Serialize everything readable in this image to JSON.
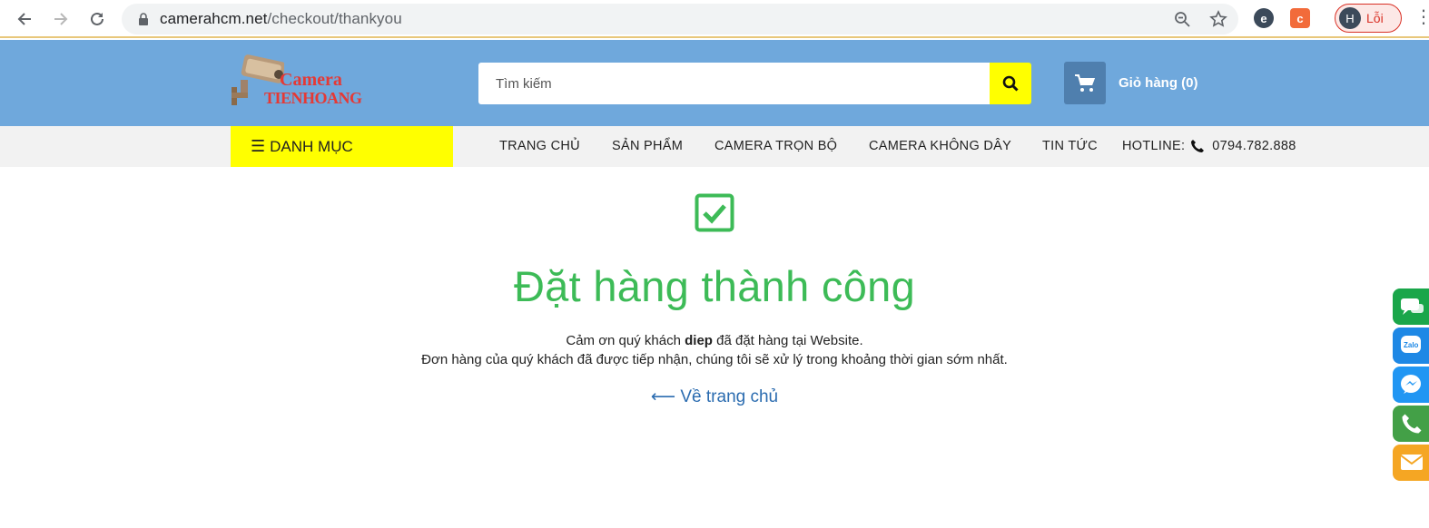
{
  "browser": {
    "url_host": "camerahcm.net",
    "url_path": "/checkout/thankyou",
    "profile_initial": "H",
    "profile_label": "Lỗi"
  },
  "header": {
    "logo_line1": "Camera",
    "logo_line2": "TIENHOANG",
    "search_placeholder": "Tìm kiếm",
    "cart_label": "Giỏ hàng (0)"
  },
  "menu": {
    "category_label": "DANH MỤC",
    "items": [
      "TRANG CHỦ",
      "SẢN PHẨM",
      "CAMERA TRỌN BỘ",
      "CAMERA KHÔNG DÂY",
      "TIN TỨC"
    ],
    "hotline_label": "HOTLINE:",
    "hotline_number": "0794.782.888"
  },
  "content": {
    "title": "Đặt hàng thành công",
    "thanks_prefix": "Cảm ơn quý khách ",
    "customer_name": "diep",
    "thanks_suffix": " đã đặt hàng tại Website.",
    "order_received": "Đơn hàng của quý khách đã được tiếp nhận, chúng tôi sẽ xử lý trong khoảng thời gian sớm nhất.",
    "back_link": "⟵ Về trang chủ"
  },
  "float_contacts": [
    {
      "icon": "sms-icon",
      "color": "#1aa64a"
    },
    {
      "icon": "zalo-icon",
      "color": "#1e88e5"
    },
    {
      "icon": "messenger-icon",
      "color": "#2196f3"
    },
    {
      "icon": "phone-icon",
      "color": "#43a047"
    },
    {
      "icon": "email-icon",
      "color": "#f5a623"
    }
  ],
  "colors": {
    "header_bg": "#6fa8dc",
    "accent_yellow": "#ffff00",
    "success_green": "#3dbb57",
    "link_blue": "#2b6cb0"
  }
}
